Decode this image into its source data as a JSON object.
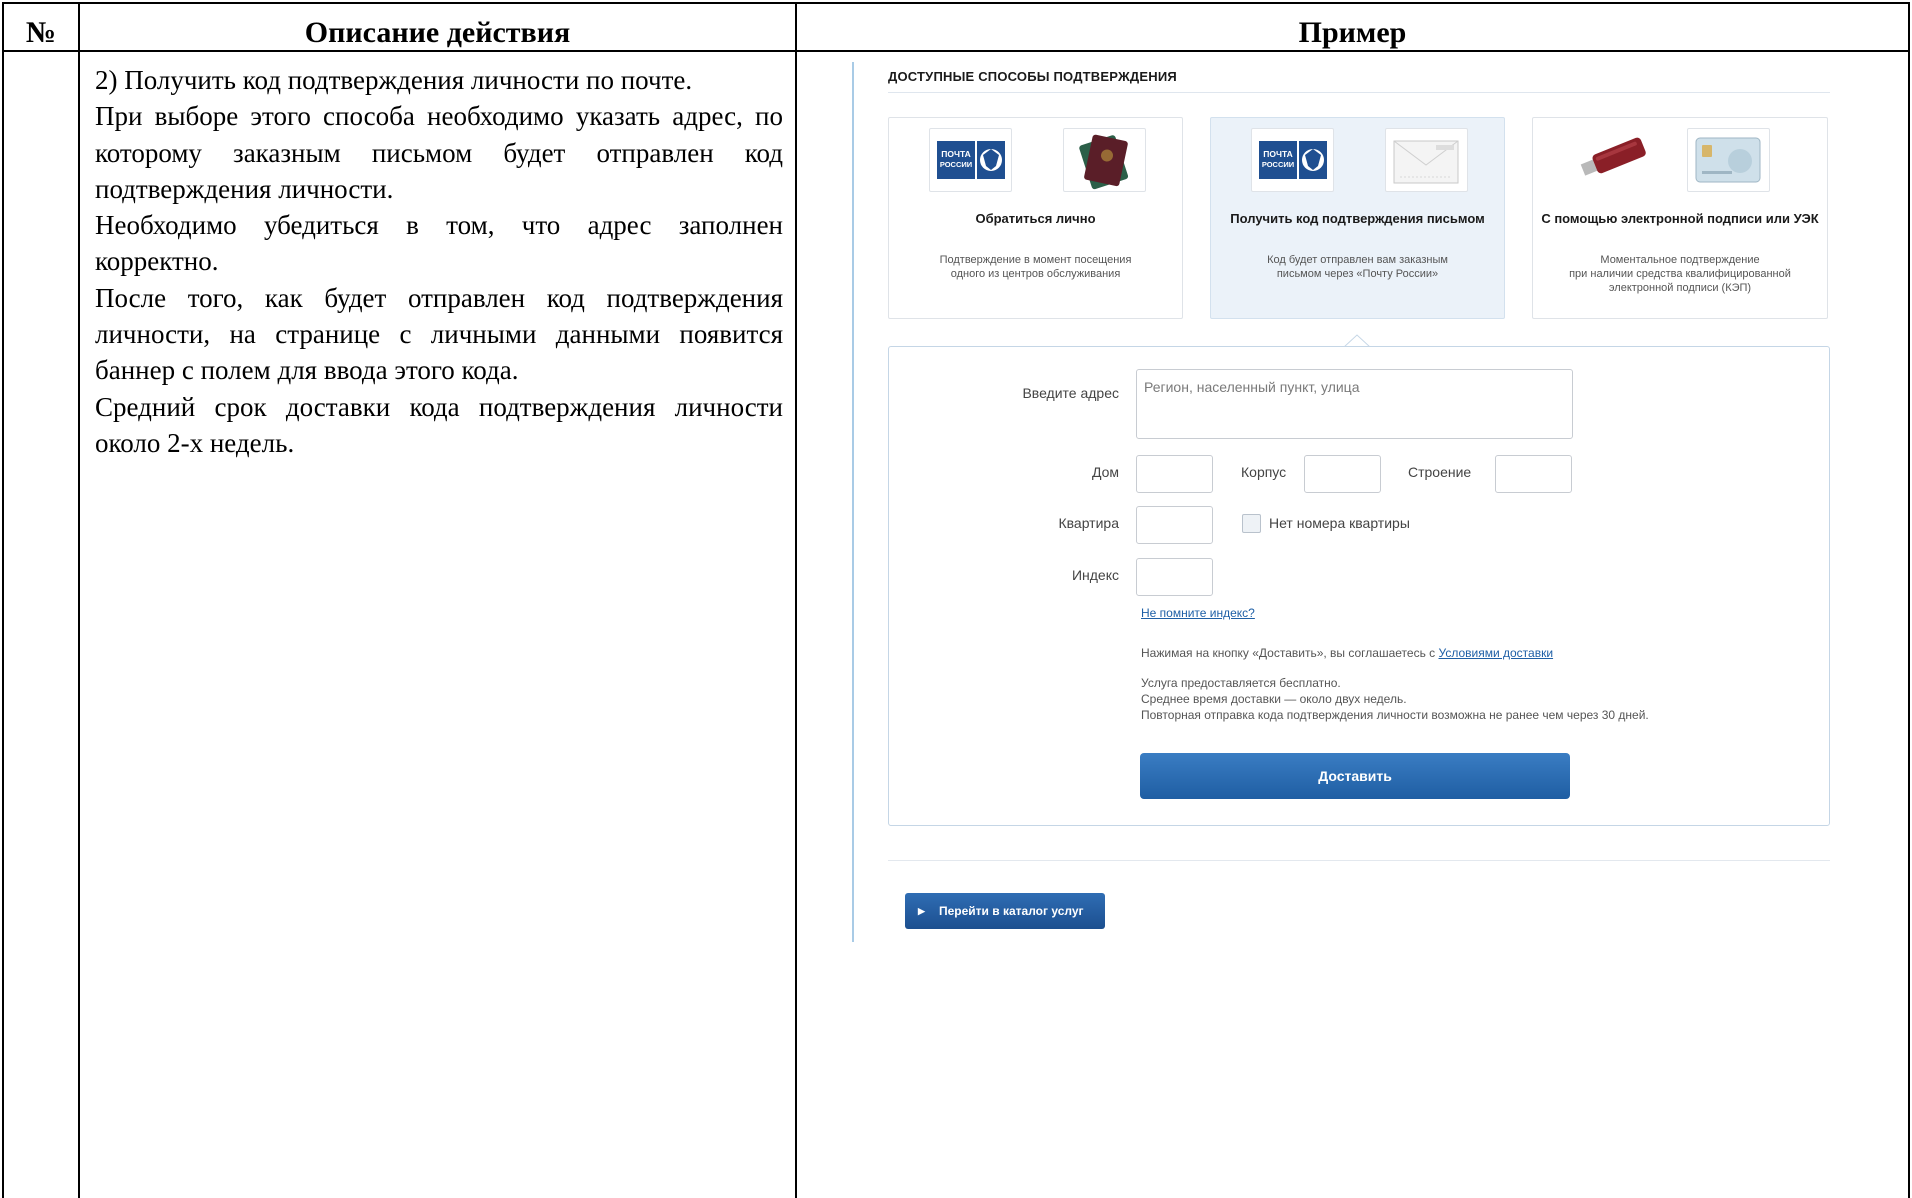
{
  "table": {
    "col_num_header": "№",
    "col_desc_header": "Описание действия",
    "col_example_header": "Пример"
  },
  "description": {
    "paragraphs": [
      "2) Получить код подтверждения личности по почте.",
      "При выборе этого способа необходимо указать адрес, по которому заказным письмом будет отправлен код подтверждения личности.",
      "Необходимо убедиться в том, что адрес заполнен корректно.",
      "После того, как будет отправлен код подтверждения личности, на странице с личными данными появится баннер с полем для ввода этого кода.",
      "Средний срок доставки кода подтверждения личности около 2-х недель."
    ]
  },
  "screenshot": {
    "section_title": "ДОСТУПНЫЕ СПОСОБЫ ПОДТВЕРЖДЕНИЯ",
    "post_logo_text": "ПОЧТА РОССИИ",
    "methods": [
      {
        "title": "Обратиться лично",
        "desc1": "Подтверждение в момент посещения",
        "desc2": "одного из центров обслуживания",
        "desc3": ""
      },
      {
        "title": "Получить код подтверждения письмом",
        "desc1": "Код будет отправлен вам заказным",
        "desc2": "письмом через «Почту России»",
        "desc3": ""
      },
      {
        "title": "С помощью электронной подписи или УЭК",
        "desc1": "Моментальное подтверждение",
        "desc2": "при наличии средства квалифицированной",
        "desc3": "электронной подписи (КЭП)"
      }
    ],
    "form": {
      "address_label": "Введите адрес",
      "address_placeholder": "Регион, населенный пункт, улица",
      "house_label": "Дом",
      "korpus_label": "Корпус",
      "building_label": "Строение",
      "apartment_label": "Квартира",
      "no_apartment_label": "Нет номера квартиры",
      "index_label": "Индекс",
      "forgot_index_link": "Не помните индекс?",
      "terms_text": "Нажимая на кнопку «Доставить», вы соглашаетесь с",
      "terms_link": "Условиями доставки",
      "info1": "Услуга предоставляется бесплатно.",
      "info2": "Среднее время доставки — около двух недель.",
      "info3": "Повторная отправка кода подтверждения личности возможна не ранее чем через 30 дней.",
      "deliver_button": "Доставить"
    },
    "catalog_button": "Перейти в каталог услуг"
  }
}
